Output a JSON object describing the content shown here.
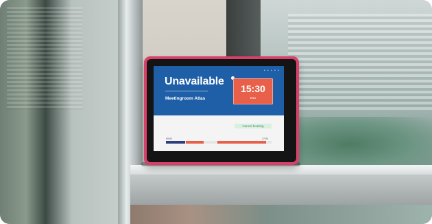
{
  "screen": {
    "status": "Unavailable",
    "room_name": "Meetingroom Atlas",
    "time": "15:30",
    "time_caption": "END",
    "cancel_label": "Cancel booking",
    "timeline_start": "09:00",
    "timeline_end": "17:00",
    "menu_dots": "• • • • •"
  },
  "colors": {
    "header_blue": "#1e5fa8",
    "time_card_orange": "#e8604a",
    "device_frame_pink": "#d8406a",
    "cancel_green_bg": "#d9efe0",
    "timeline_blue": "#2e3f7f",
    "timeline_orange": "#e8604a"
  },
  "timeline_segments": [
    {
      "kind": "booked-past",
      "start": 0.0,
      "end": 0.18,
      "color": "#2e3f7f"
    },
    {
      "kind": "booked",
      "start": 0.19,
      "end": 0.36,
      "color": "#e8604a"
    },
    {
      "kind": "free",
      "start": 0.36,
      "end": 0.48,
      "color": "#e6e6e6"
    },
    {
      "kind": "booked",
      "start": 0.49,
      "end": 0.95,
      "color": "#e8604a"
    }
  ]
}
